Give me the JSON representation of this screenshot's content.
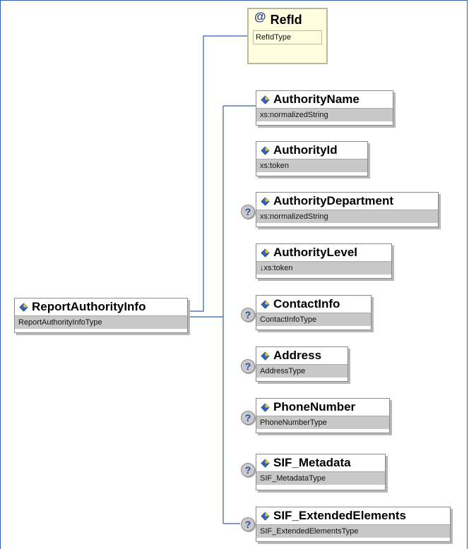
{
  "root": {
    "name": "ReportAuthorityInfo",
    "type": "ReportAuthorityInfoType"
  },
  "attribute": {
    "symbol": "@",
    "name": "RefId",
    "type": "RefIdType"
  },
  "elements": [
    {
      "name": "AuthorityName",
      "type": "xs:normalizedString",
      "optional": false
    },
    {
      "name": "AuthorityId",
      "type": "xs:token",
      "optional": false
    },
    {
      "name": "AuthorityDepartment",
      "type": "xs:normalizedString",
      "optional": true
    },
    {
      "name": "AuthorityLevel",
      "type": "↓xs:token",
      "optional": false
    },
    {
      "name": "ContactInfo",
      "type": "ContactInfoType",
      "optional": true
    },
    {
      "name": "Address",
      "type": "AddressType",
      "optional": true
    },
    {
      "name": "PhoneNumber",
      "type": "PhoneNumberType",
      "optional": true
    },
    {
      "name": "SIF_Metadata",
      "type": "SIF_MetadataType",
      "optional": true
    },
    {
      "name": "SIF_ExtendedElements",
      "type": "SIF_ExtendedElementsType",
      "optional": true
    }
  ],
  "optional_marker": "?",
  "colors": {
    "frame": "#2f5fb0",
    "connector": "#2f5fb0",
    "attribute_bg": "#ffffe0",
    "type_bar": "#c8c8c8"
  },
  "icons": {
    "element": "element-diamond-icon",
    "optional": "optional-question-icon"
  }
}
